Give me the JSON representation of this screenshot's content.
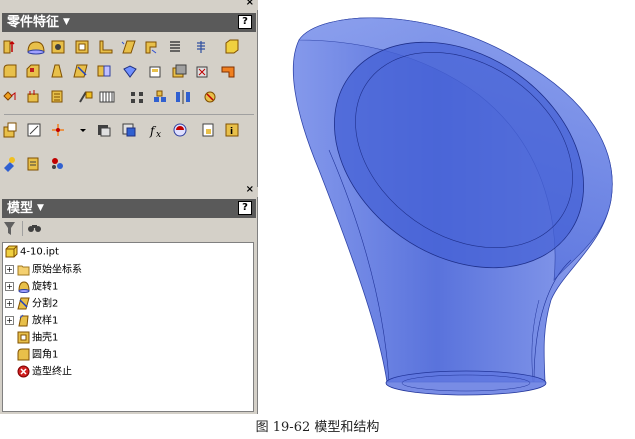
{
  "features_panel": {
    "title": "零件特征",
    "help": "?"
  },
  "model_panel": {
    "title": "模型",
    "help": "?"
  },
  "tree": [
    {
      "label": "4-10.ipt",
      "icon": "part-icon"
    },
    {
      "label": "原始坐标系",
      "icon": "folder-icon"
    },
    {
      "label": "旋转1",
      "icon": "revolve-icon"
    },
    {
      "label": "分割2",
      "icon": "split-icon"
    },
    {
      "label": "放样1",
      "icon": "loft-icon"
    },
    {
      "label": "抽壳1",
      "icon": "shell-icon"
    },
    {
      "label": "圆角1",
      "icon": "fillet-icon"
    },
    {
      "label": "造型终止",
      "icon": "end-of-part-icon"
    }
  ],
  "toolbar_function_label": "fx",
  "caption": "图 19-62  模型和结构",
  "colors": {
    "panel_bg": "#d4d0c8",
    "titlebar_bg": "#5a5a5a",
    "model_blue": "#3f5fd8"
  }
}
